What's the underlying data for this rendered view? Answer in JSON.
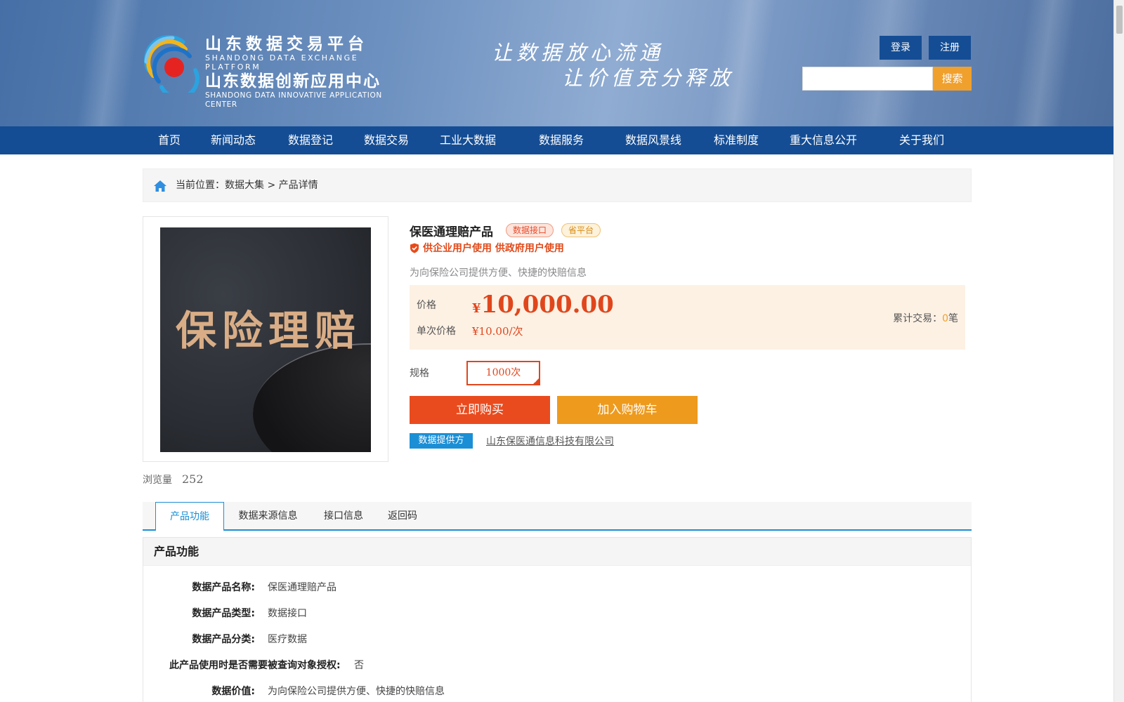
{
  "header": {
    "logo": {
      "cn_line1": "山东数据交易平台",
      "en_line1": "SHANDONG DATA EXCHANGE PLATFORM",
      "cn_line2": "山东数据创新应用中心",
      "en_line2": "SHANDONG DATA INNOVATIVE APPLICATION CENTER"
    },
    "slogan_line1": "让数据放心流通",
    "slogan_line2": "让价值充分释放",
    "login_label": "登录",
    "register_label": "注册",
    "search_value": "",
    "search_button": "搜索"
  },
  "nav": {
    "items": [
      "首页",
      "新闻动态",
      "数据登记",
      "数据交易",
      "工业大数据",
      "数据服务",
      "数据风景线",
      "标准制度",
      "重大信息公开",
      "关于我们"
    ]
  },
  "breadcrumb": {
    "text": "当前位置：数据大集 > 产品详情"
  },
  "product": {
    "image_text": "保险理赔",
    "title": "保医通理赔产品",
    "tag_type": "数据接口",
    "tag_platform": "省平台",
    "usage": "供企业用户使用 供政府用户使用",
    "description": "为向保险公司提供方便、快捷的快赔信息",
    "price_label": "价格",
    "price_currency": "¥",
    "price_value": "10,000.00",
    "unit_price_label": "单次价格",
    "unit_price_value": "¥10.00/次",
    "trade_label": "累计交易：",
    "trade_count": "0",
    "trade_unit": "笔",
    "spec_label": "规格",
    "spec_option": "1000次",
    "buy_button": "立即购买",
    "cart_button": "加入购物车",
    "provider_label": "数据提供方",
    "provider_name": "山东保医通信息科技有限公司",
    "views_label": "浏览量",
    "views_count": "252"
  },
  "tabs": [
    "产品功能",
    "数据来源信息",
    "接口信息",
    "返回码"
  ],
  "function_panel": {
    "title": "产品功能",
    "rows": [
      {
        "key": "数据产品名称:",
        "value": "保医通理赔产品"
      },
      {
        "key": "数据产品类型:",
        "value": "数据接口"
      },
      {
        "key": "数据产品分类:",
        "value": "医疗数据"
      },
      {
        "key": "此产品使用时是否需要被查询对象授权:",
        "value": "否"
      },
      {
        "key": "数据价值:",
        "value": "为向保险公司提供方便、快捷的快赔信息"
      }
    ]
  },
  "colors": {
    "nav_blue": "#144d94",
    "accent_orange": "#f0a02c",
    "price_red": "#e0461c",
    "tab_blue": "#1a8fd6"
  }
}
